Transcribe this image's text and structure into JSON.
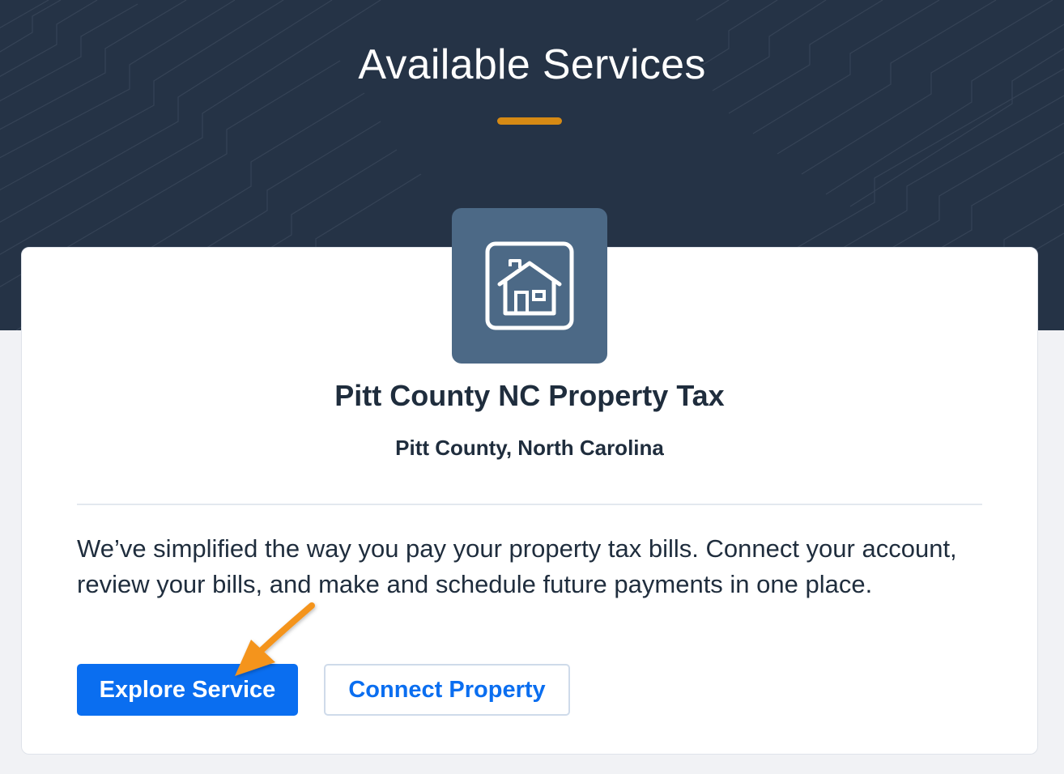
{
  "header": {
    "title": "Available Services",
    "accent_color": "#d68a14",
    "background_color": "#253346"
  },
  "service": {
    "icon": "house-icon",
    "icon_tile_color": "#4c6986",
    "title": "Pitt County NC Property Tax",
    "location": "Pitt County, North Carolina",
    "description": "We’ve simplified the way you pay your property tax bills. Connect your account, review your bills, and make and schedule future payments in one place.",
    "primary_button_label": "Explore Service",
    "secondary_button_label": "Connect Property",
    "button_color": "#0a6ef0"
  },
  "annotation": {
    "icon": "pointer-arrow-icon",
    "color": "#f4941e"
  }
}
